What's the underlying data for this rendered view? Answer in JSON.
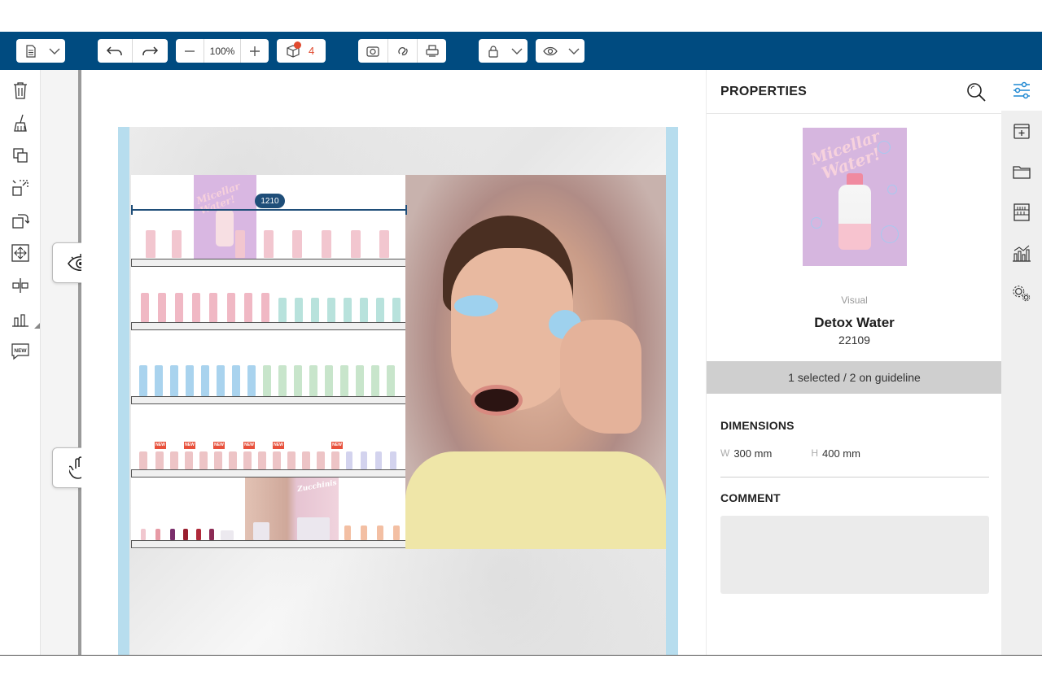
{
  "toolbar": {
    "zoom_value": "100%",
    "cart_count": "4"
  },
  "canvas": {
    "measure_label": "1210",
    "shelf_badges": [
      "NEW",
      "NEW",
      "NEW",
      "NEW",
      "NEW",
      "NEW"
    ],
    "mini_poster_text": "Micellar Water!",
    "mini_poster2_text": "Zucchinis"
  },
  "left_tools": [
    "trash-icon",
    "broom-icon",
    "duplicate-icon",
    "transform-icon",
    "rotate-icon",
    "fit-icon",
    "align-center-icon",
    "bar-chart-icon",
    "new-badge-icon"
  ],
  "floating_tools": [
    "eye-icon",
    "hand-icon"
  ],
  "panel": {
    "title": "PROPERTIES",
    "poster_text_1": "Micellar",
    "poster_text_2": "Water!",
    "item_type": "Visual",
    "item_name": "Detox Water",
    "item_code": "22109",
    "selection_status": "1 selected / 2 on guideline",
    "dimensions_header": "DIMENSIONS",
    "width_label": "W",
    "width_value": "300 mm",
    "height_label": "H",
    "height_value": "400 mm",
    "comment_header": "COMMENT"
  },
  "right_rail": [
    "sliders-icon",
    "add-page-icon",
    "folder-icon",
    "shelf-icon",
    "analytics-icon",
    "settings-icon"
  ],
  "colors": {
    "toolbar_bg": "#004b80",
    "accent": "#1e88d2",
    "count_red": "#e04a2f",
    "board_blue": "#b7ddee"
  }
}
